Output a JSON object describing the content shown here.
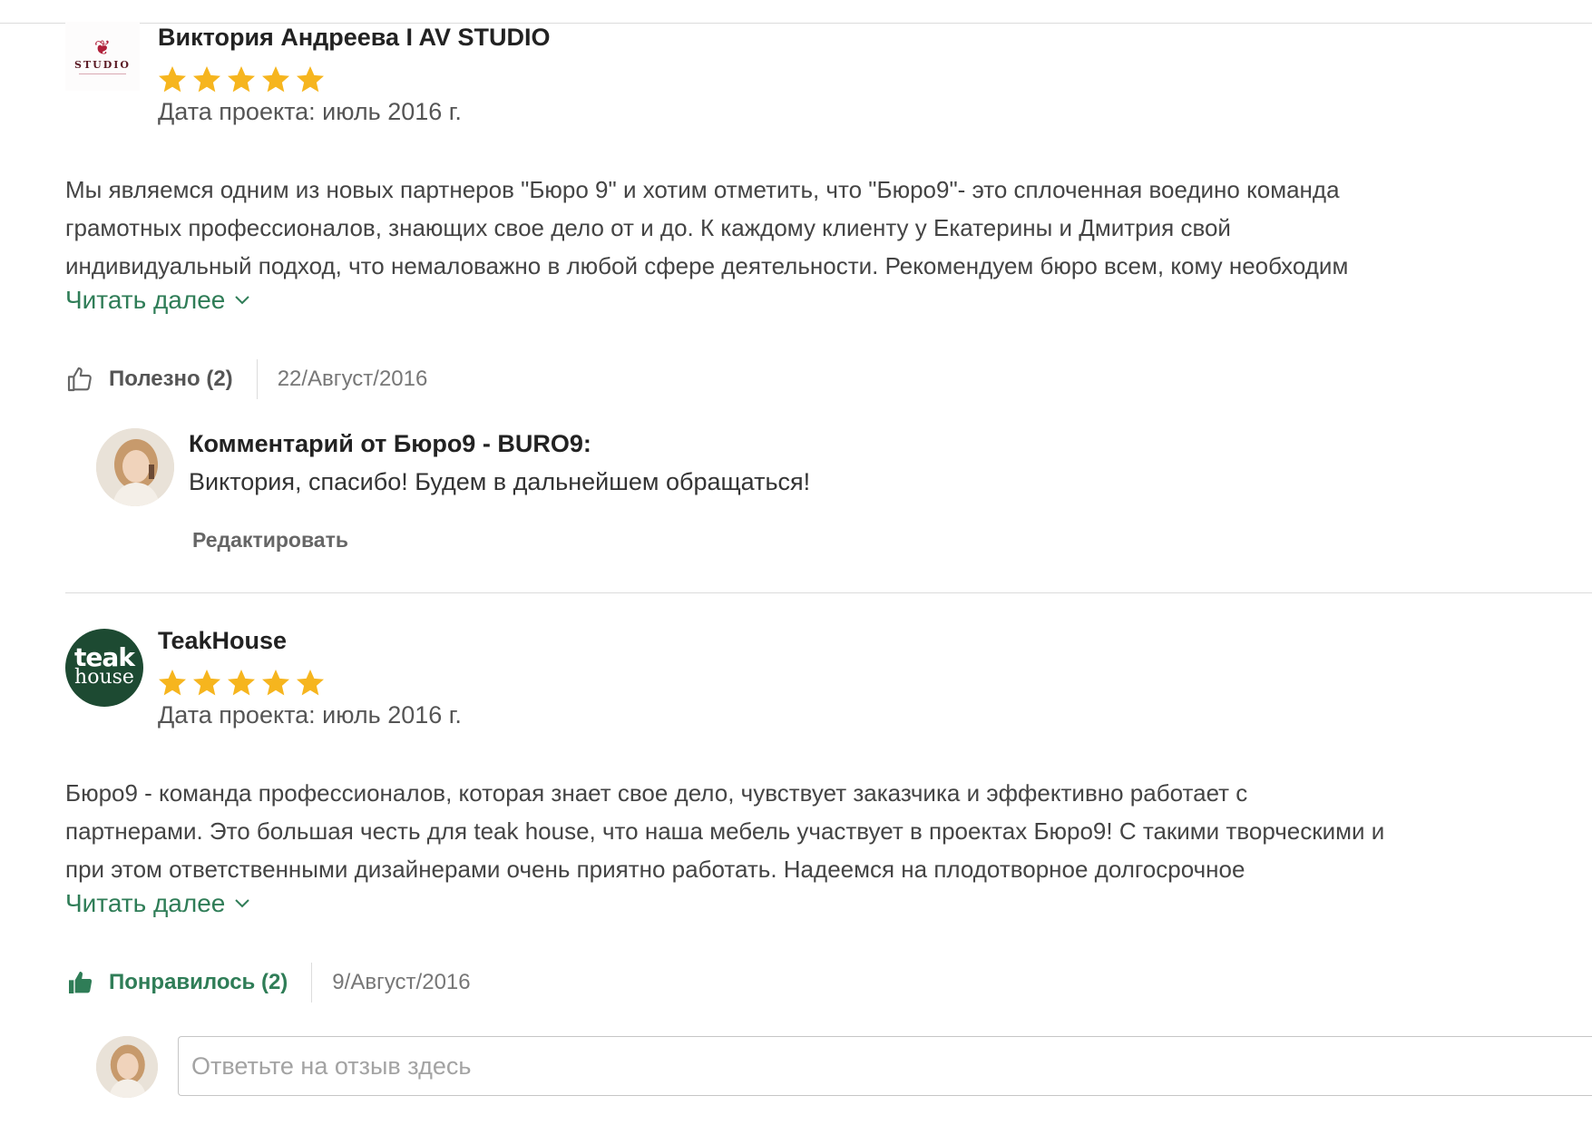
{
  "reviews": [
    {
      "reviewer_name": "Виктория Андреева I AV STUDIO",
      "logo_text": "STUDIO",
      "rating": 5,
      "project_date": "Дата проекта: июль 2016 г.",
      "body_lines": [
        "Мы являемся одним из новых партнеров \"Бюро 9\" и хотим отметить, что \"Бюро9\"- это сплоченная воедино команда",
        "грамотных профессионалов, знающих свое дело от и до. К каждому клиенту у Екатерины и Дмитрия свой",
        "индивидуальный подход, что немаловажно в любой сфере деятельности. Рекомендуем бюро всем, кому необходим"
      ],
      "read_more": "Читать далее",
      "like_label": "Полезно (2)",
      "like_active": false,
      "post_date": "22/Август/2016",
      "owner_reply": {
        "title": "Комментарий от Бюро9 - BURO9:",
        "text": "Виктория, спасибо! Будем в дальнейшем обращаться!",
        "edit_label": "Редактировать"
      }
    },
    {
      "reviewer_name": "TeakHouse",
      "logo_text_1": "teak",
      "logo_text_2": "house",
      "rating": 5,
      "project_date": "Дата проекта: июль 2016 г.",
      "body_lines": [
        "Бюро9 - команда профессионалов, которая знает свое дело, чувствует заказчика и эффективно работает с",
        "партнерами. Это большая честь для teak house, что наша мебель участвует в проектах Бюро9! С такими творческими и",
        "при этом ответственными дизайнерами очень приятно работать. Надеемся на плодотворное долгосрочное"
      ],
      "read_more": "Читать далее",
      "like_label": "Понравилось (2)",
      "like_active": true,
      "post_date": "9/Август/2016"
    }
  ],
  "reply_box": {
    "placeholder": "Ответьте на отзыв здесь"
  },
  "colors": {
    "star": "#f6b51e",
    "accent_green": "#2f7d57",
    "teak_logo": "#1d4a32",
    "studio_mark": "#b0203a"
  }
}
